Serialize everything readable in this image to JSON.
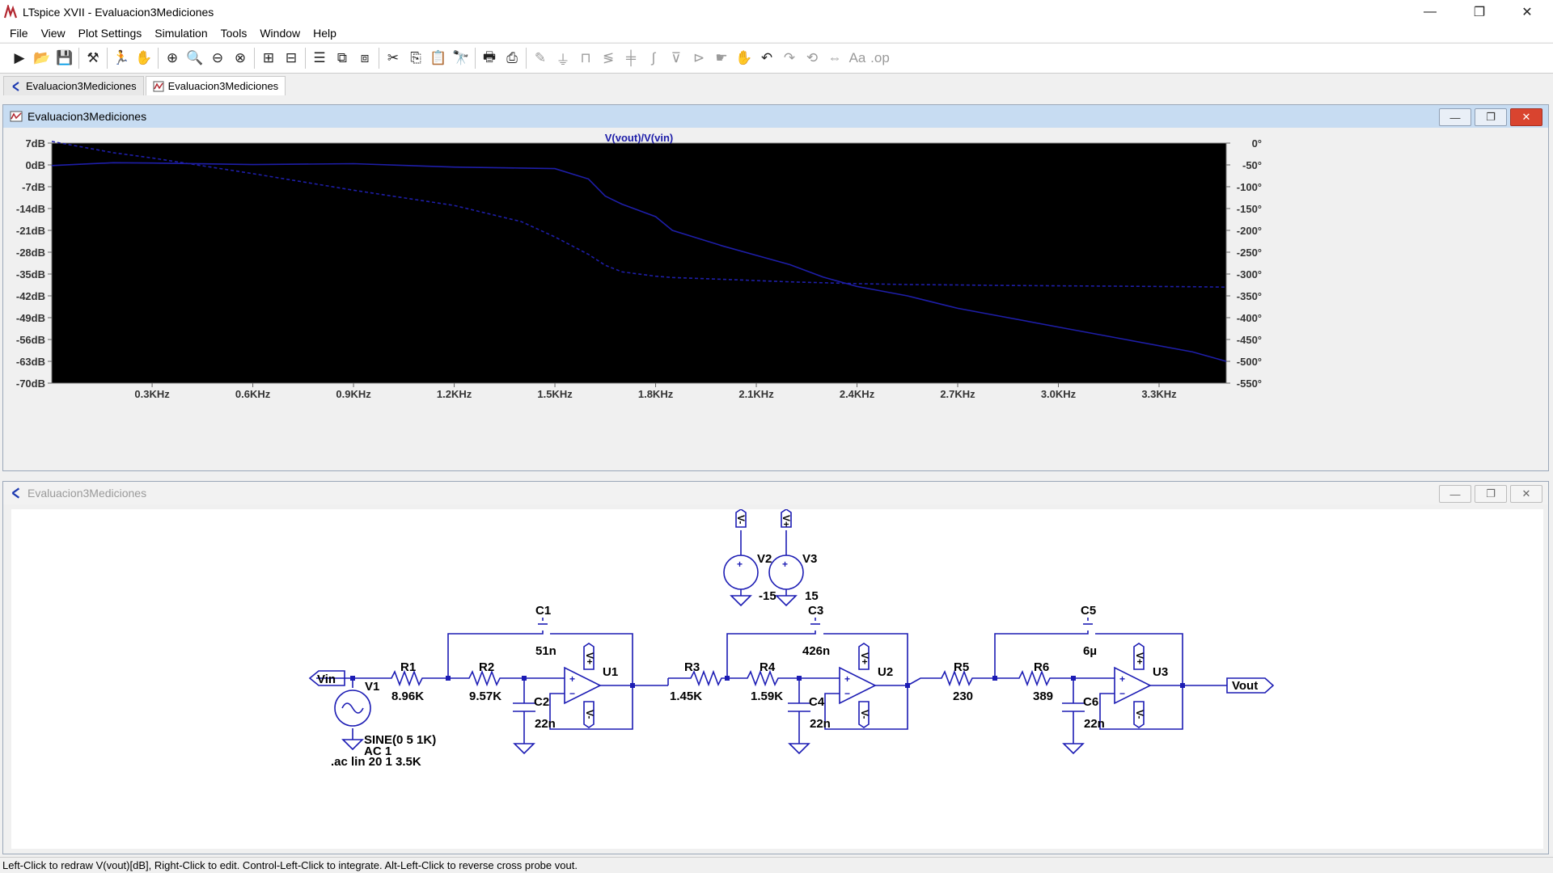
{
  "window": {
    "title": "LTspice XVII - Evaluacion3Mediciones"
  },
  "window_controls": {
    "minimize": "—",
    "restore": "❐",
    "close": "✕"
  },
  "menu": [
    "File",
    "View",
    "Plot Settings",
    "Simulation",
    "Tools",
    "Window",
    "Help"
  ],
  "tabs": [
    {
      "label": "Evaluacion3Mediciones",
      "icon": "schematic-icon"
    },
    {
      "label": "Evaluacion3Mediciones",
      "icon": "waveform-icon",
      "active": true
    }
  ],
  "plot_window": {
    "title": "Evaluacion3Mediciones"
  },
  "schematic_window": {
    "title": "Evaluacion3Mediciones"
  },
  "chart_data": {
    "type": "line",
    "title": "V(vout)/V(vin)",
    "xlabel": "",
    "ylabel": "",
    "x_ticks": [
      "0.3KHz",
      "0.6KHz",
      "0.9KHz",
      "1.2KHz",
      "1.5KHz",
      "1.8KHz",
      "2.1KHz",
      "2.4KHz",
      "2.7KHz",
      "3.0KHz",
      "3.3KHz"
    ],
    "y_left_ticks": [
      "7dB",
      "0dB",
      "-7dB",
      "-14dB",
      "-21dB",
      "-28dB",
      "-35dB",
      "-42dB",
      "-49dB",
      "-56dB",
      "-63dB",
      "-70dB"
    ],
    "y_right_ticks": [
      "0°",
      "-50°",
      "-100°",
      "-150°",
      "-200°",
      "-250°",
      "-300°",
      "-350°",
      "-400°",
      "-450°",
      "-500°",
      "-550°"
    ],
    "xlim": [
      1,
      3500
    ],
    "ylim_db": [
      -70,
      7
    ],
    "ylim_phase": [
      -550,
      0
    ],
    "grid": false,
    "series": [
      {
        "name": "V(vout)/V(vin)",
        "style": "solid",
        "x": [
          1,
          184,
          300,
          600,
          900,
          1200,
          1400,
          1500,
          1600,
          1650,
          1700,
          1800,
          1850,
          2000,
          2100,
          2200,
          2300,
          2400,
          2550,
          2700,
          2800,
          3000,
          3200,
          3400,
          3500
        ],
        "y": [
          -0.2,
          0.7,
          0.6,
          0.1,
          0.4,
          -0.7,
          -1.0,
          -1.2,
          -4.5,
          -10,
          -12.6,
          -16.6,
          -21,
          -26,
          -29,
          -32,
          -36,
          -39,
          -42,
          -46,
          -48,
          -52,
          -56,
          -60,
          -63
        ]
      },
      {
        "name": "",
        "style": "dashed",
        "x": [
          1,
          184,
          300,
          600,
          900,
          1200,
          1400,
          1500,
          1600,
          1650,
          1700,
          1800,
          1850,
          2000,
          2100,
          2200,
          2300,
          2400,
          2550,
          2700,
          2800,
          3000,
          3200,
          3400,
          3500
        ],
        "y": [
          20,
          -22,
          -34,
          -70,
          -108,
          -143,
          -180,
          -215,
          -255,
          -280,
          -295,
          -305,
          -308,
          -312,
          -315,
          -318,
          -320,
          -322,
          -324,
          -325,
          -326,
          -327,
          -328,
          -329,
          -330
        ]
      }
    ]
  },
  "schematic": {
    "labels": {
      "vin": "Vin",
      "vout": "Vout",
      "v1": "V1",
      "v1_value": "SINE(0 5 1K)",
      "v1_ac": "AC 1",
      "directive": ".ac lin 20 1 3.5K",
      "v2": "V2",
      "v2_value": "-15",
      "v3": "V3",
      "v3_value": "15",
      "r1": "R1",
      "r1_value": "8.96K",
      "r2": "R2",
      "r2_value": "9.57K",
      "r3": "R3",
      "r3_value": "1.45K",
      "r4": "R4",
      "r4_value": "1.59K",
      "r5": "R5",
      "r5_value": "230",
      "r6": "R6",
      "r6_value": "389",
      "c1": "C1",
      "c1_value": "51n",
      "c2": "C2",
      "c2_value": "22n",
      "c3": "C3",
      "c3_value": "426n",
      "c4": "C4",
      "c4_value": "22n",
      "c5": "C5",
      "c5_value": "6µ",
      "c6": "C6",
      "c6_value": "22n",
      "u1": "U1",
      "u2": "U2",
      "u3": "U3",
      "vplus": "V+",
      "vminus": "V-",
      "plus": "+",
      "minus": "−"
    }
  },
  "status": "Left-Click to redraw V(vout)[dB],  Right-Click to edit. Control-Left-Click to integrate. Alt-Left-Click to reverse cross probe vout."
}
